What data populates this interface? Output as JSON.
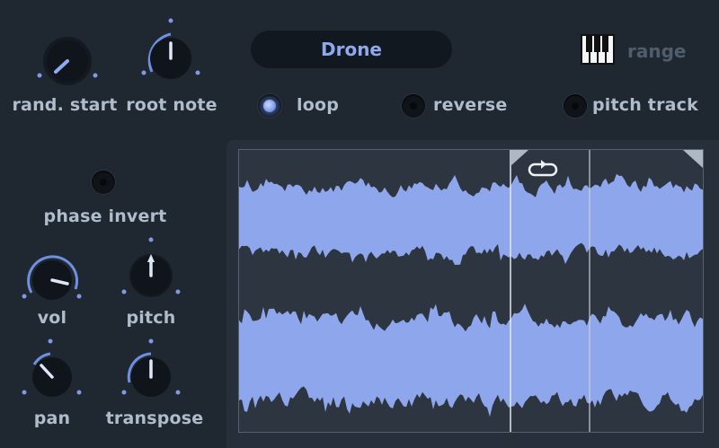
{
  "knobs": {
    "rand_start": {
      "label": "rand. start"
    },
    "root_note": {
      "label": "root note"
    },
    "vol": {
      "label": "vol"
    },
    "pitch": {
      "label": "pitch"
    },
    "pan": {
      "label": "pan"
    },
    "transpose": {
      "label": "transpose"
    }
  },
  "preset": {
    "name": "Drone"
  },
  "range": {
    "label": "range"
  },
  "toggles": {
    "loop": {
      "label": "loop",
      "on": true
    },
    "reverse": {
      "label": "reverse",
      "on": false
    },
    "pitch_track": {
      "label": "pitch track",
      "on": false
    },
    "phase_invert": {
      "label": "phase invert",
      "on": false
    }
  },
  "colors": {
    "accent": "#8fa8ee",
    "wave_fill": "#8ea6ec",
    "background": "#1f2730"
  }
}
